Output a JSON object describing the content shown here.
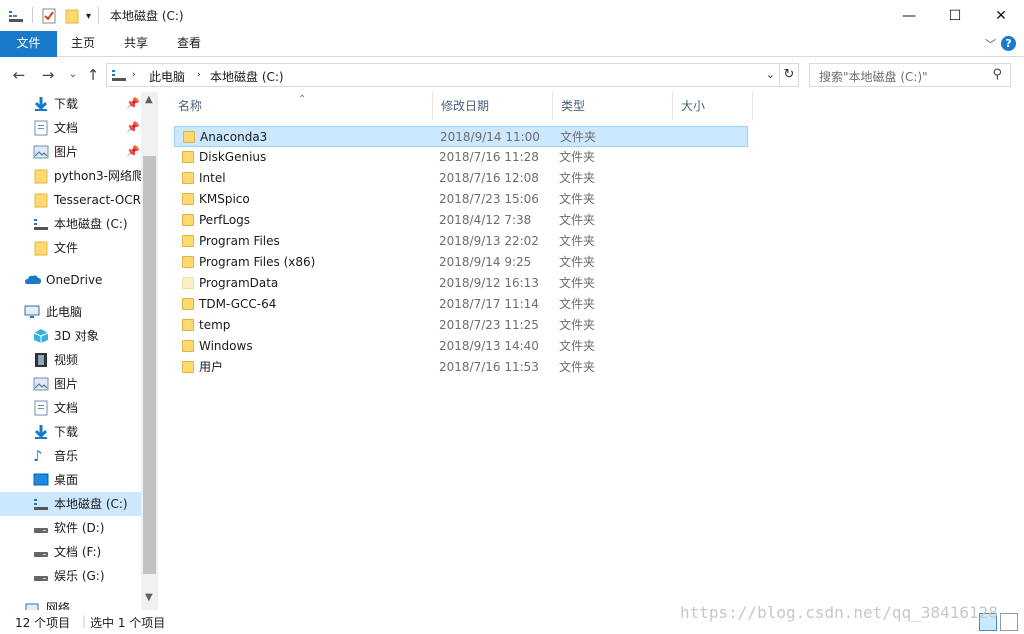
{
  "window": {
    "title": "本地磁盘 (C:)",
    "minimize": "—",
    "maximize": "☐",
    "close": "✕"
  },
  "ribbon": {
    "tabs": [
      "文件",
      "主页",
      "共享",
      "查看"
    ],
    "help": "?"
  },
  "address": {
    "crumbs": [
      "此电脑",
      "本地磁盘 (C:)"
    ],
    "search_placeholder": "搜索\"本地磁盘 (C:)\""
  },
  "nav": {
    "quick_access": [
      {
        "label": "下载",
        "icon": "download-icon",
        "pinned": true
      },
      {
        "label": "文档",
        "icon": "document-icon",
        "pinned": true
      },
      {
        "label": "图片",
        "icon": "picture-icon",
        "pinned": true
      },
      {
        "label": "python3-网络爬",
        "icon": "folder-icon",
        "pinned": false
      },
      {
        "label": "Tesseract-OCR",
        "icon": "folder-icon",
        "pinned": false
      },
      {
        "label": "本地磁盘 (C:)",
        "icon": "drive-icon",
        "pinned": false
      },
      {
        "label": "文件",
        "icon": "folder-icon",
        "pinned": false
      }
    ],
    "onedrive": "OneDrive",
    "this_pc": "此电脑",
    "pc_items": [
      {
        "label": "3D 对象",
        "icon": "3d-objects-icon"
      },
      {
        "label": "视频",
        "icon": "video-icon"
      },
      {
        "label": "图片",
        "icon": "picture-icon"
      },
      {
        "label": "文档",
        "icon": "document-icon"
      },
      {
        "label": "下载",
        "icon": "download-icon"
      },
      {
        "label": "音乐",
        "icon": "music-icon"
      },
      {
        "label": "桌面",
        "icon": "desktop-icon"
      },
      {
        "label": "本地磁盘 (C:)",
        "icon": "drive-icon",
        "selected": true
      },
      {
        "label": "软件 (D:)",
        "icon": "drive-icon"
      },
      {
        "label": "文档 (F:)",
        "icon": "drive-icon"
      },
      {
        "label": "娱乐 (G:)",
        "icon": "drive-icon"
      }
    ],
    "network": "网络"
  },
  "columns": {
    "name": "名称",
    "date": "修改日期",
    "type": "类型",
    "size": "大小"
  },
  "files": [
    {
      "name": "Anaconda3",
      "date": "2018/9/14 11:00",
      "type": "文件夹",
      "selected": true
    },
    {
      "name": "DiskGenius",
      "date": "2018/7/16 11:28",
      "type": "文件夹"
    },
    {
      "name": "Intel",
      "date": "2018/7/16 12:08",
      "type": "文件夹"
    },
    {
      "name": "KMSpico",
      "date": "2018/7/23 15:06",
      "type": "文件夹"
    },
    {
      "name": "PerfLogs",
      "date": "2018/4/12 7:38",
      "type": "文件夹"
    },
    {
      "name": "Program Files",
      "date": "2018/9/13 22:02",
      "type": "文件夹"
    },
    {
      "name": "Program Files (x86)",
      "date": "2018/9/14 9:25",
      "type": "文件夹"
    },
    {
      "name": "ProgramData",
      "date": "2018/9/12 16:13",
      "type": "文件夹",
      "hidden": true
    },
    {
      "name": "TDM-GCC-64",
      "date": "2018/7/17 11:14",
      "type": "文件夹"
    },
    {
      "name": "temp",
      "date": "2018/7/23 11:25",
      "type": "文件夹"
    },
    {
      "name": "Windows",
      "date": "2018/9/13 14:40",
      "type": "文件夹"
    },
    {
      "name": "用户",
      "date": "2018/7/16 11:53",
      "type": "文件夹"
    }
  ],
  "status": {
    "count": "12 个项目",
    "selected": "选中 1 个项目"
  },
  "watermark": "https://blog.csdn.net/qq_38416128",
  "colors": {
    "accent": "#1979ca",
    "selection": "#cce8ff",
    "folder": "#ffd970"
  }
}
